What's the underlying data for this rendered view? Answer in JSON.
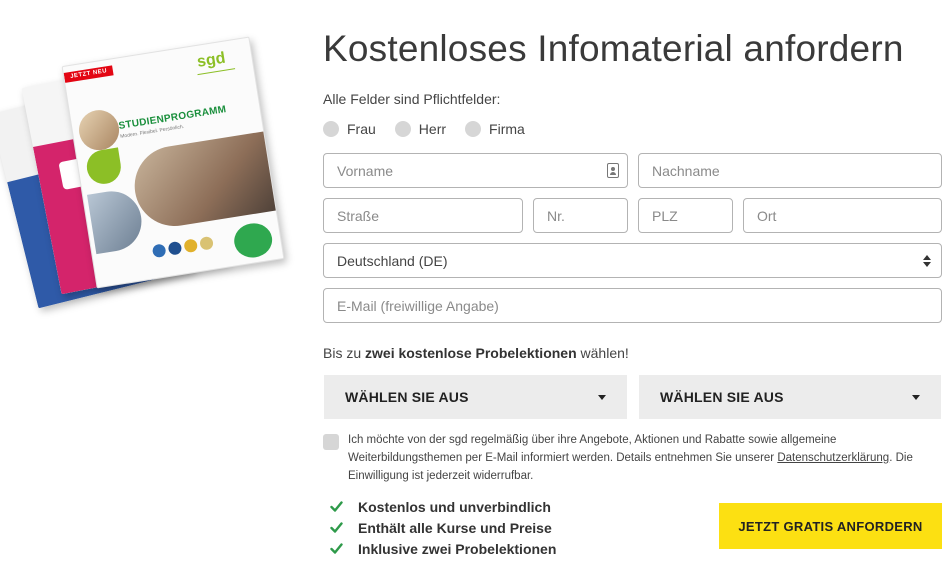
{
  "brochure": {
    "badge": "JETZT NEU",
    "logo": "sgd",
    "title": "STUDIENPROGRAMM",
    "subtitle": "Modern. Flexibel. Persönlich."
  },
  "form": {
    "title": "Kostenloses Infomaterial anfordern",
    "required_hint": "Alle Felder sind Pflichtfelder:",
    "salutation_options": [
      "Frau",
      "Herr",
      "Firma"
    ],
    "fields": {
      "vorname_placeholder": "Vorname",
      "nachname_placeholder": "Nachname",
      "strasse_placeholder": "Straße",
      "nr_placeholder": "Nr.",
      "plz_placeholder": "PLZ",
      "ort_placeholder": "Ort",
      "country_value": "Deutschland (DE)",
      "email_placeholder": "E-Mail (freiwillige Angabe)"
    },
    "probe": {
      "prefix": "Bis zu ",
      "bold": "zwei kostenlose Probelektionen",
      "suffix": " wählen!"
    },
    "lesson_selects": [
      "WÄHLEN SIE AUS",
      "WÄHLEN SIE AUS"
    ],
    "consent": {
      "text_before": "Ich möchte von der sgd regelmäßig über ihre Angebote, Aktionen und Rabatte sowie allgemeine Weiterbildungsthemen per E-Mail informiert werden. Details entnehmen Sie unserer ",
      "link": "Datenschutzerklärung",
      "text_after": ". Die Einwilligung ist jederzeit widerrufbar."
    },
    "benefits": [
      "Kostenlos und unverbindlich",
      "Enthält alle Kurse und Preise",
      "Inklusive zwei Probelektionen"
    ],
    "submit_label": "JETZT GRATIS ANFORDERN"
  },
  "colors": {
    "accent_yellow": "#fce012",
    "check_green": "#2e9a4a",
    "brand_green": "#8cbf26"
  },
  "icons": {
    "contact": "contact-card-icon",
    "select": "sort-arrows-icon",
    "dropdown": "caret-down-icon",
    "check": "check-icon"
  }
}
